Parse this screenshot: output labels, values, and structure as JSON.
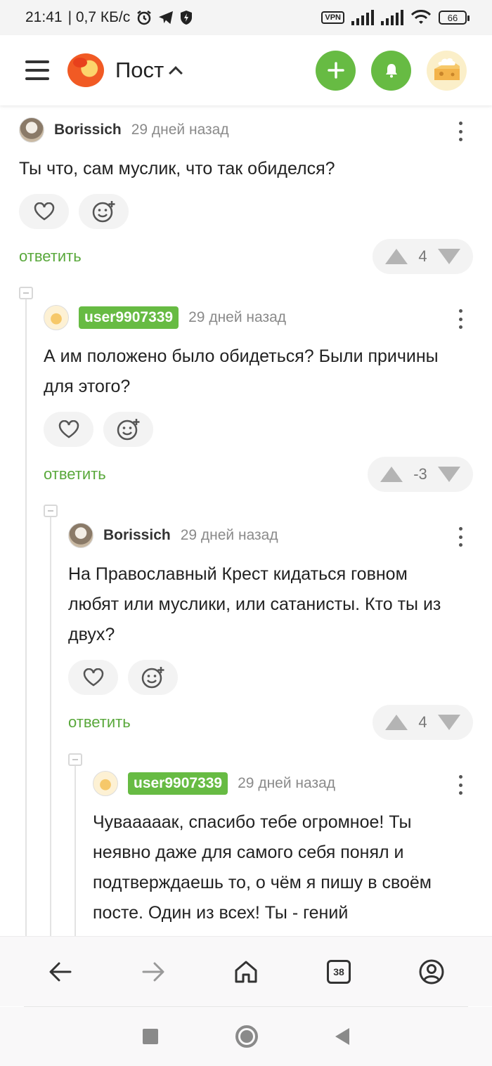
{
  "status_bar": {
    "time": "21:41",
    "speed": "| 0,7 КБ/с",
    "vpn_label": "VPN",
    "battery": "66"
  },
  "header": {
    "title": "Пост",
    "brand_color": "#67bb43"
  },
  "comments": [
    {
      "author": "Borissich",
      "author_badge": false,
      "time": "29 дней назад",
      "text": "Ты что, сам муслик, что так обиделся?",
      "reply_label": "ответить",
      "rating": "4"
    },
    {
      "author": "user9907339",
      "author_badge": true,
      "time": "29 дней назад",
      "text": "А им положено было обидеться? Были причины для этого?",
      "reply_label": "ответить",
      "rating": "-3"
    },
    {
      "author": "Borissich",
      "author_badge": false,
      "time": "29 дней назад",
      "text": "На Православный Крест кидаться говном любят или муслики, или сатанисты. Кто ты из двух?",
      "reply_label": "ответить",
      "rating": "4"
    },
    {
      "author": "user9907339",
      "author_badge": true,
      "time": "29 дней назад",
      "text": "Чувааааак, спасибо тебе огромное! Ты неявно даже для самого себя понял и подтверждаешь то, о чём я пишу в своём посте. Один из всех! Ты - гений"
    }
  ],
  "browser_nav": {
    "tabs_count": "38"
  },
  "icons": {
    "menu": "hamburger-icon",
    "add": "plus-icon",
    "notifications": "bell-icon",
    "like": "heart-icon",
    "reaction": "emoji-add-icon",
    "upvote": "arrow-up-icon",
    "downvote": "arrow-down-icon",
    "more": "kebab-icon",
    "back": "arrow-left-icon",
    "forward": "arrow-right-icon",
    "home": "home-icon",
    "profile": "profile-icon"
  }
}
